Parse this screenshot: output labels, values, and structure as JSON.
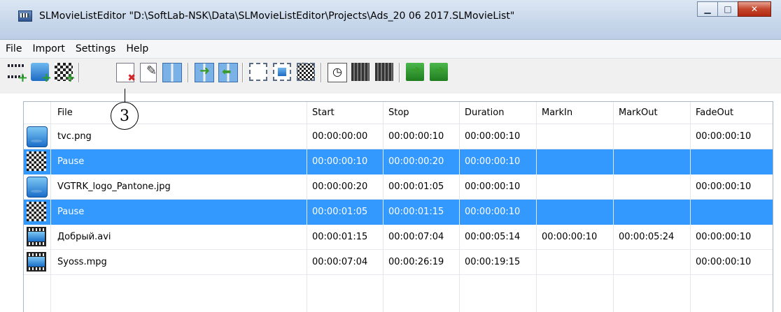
{
  "window": {
    "title": "SLMovieListEditor \"D:\\SoftLab-NSK\\Data\\SLMovieListEditor\\Projects\\Ads_20 06 2017.SLMovieList\"",
    "minimize_icon": "minimize-icon",
    "maximize_icon": "maximize-icon",
    "close_icon": "close-icon"
  },
  "menu": [
    "File",
    "Import",
    "Settings",
    "Help"
  ],
  "toolbar": {
    "icons": [
      "add-video-icon",
      "add-image-icon",
      "add-pause-icon",
      "delete-item-icon",
      "edit-item-icon",
      "split-icon",
      "move-right-icon",
      "move-left-icon",
      "frame-empty-icon",
      "frame-image-icon",
      "frame-checker-icon",
      "clock-icon",
      "video-strip-icon",
      "video-strip-2-icon",
      "copy-forward-icon",
      "copy-back-icon"
    ]
  },
  "callout": {
    "label": "3"
  },
  "table": {
    "columns": [
      "File",
      "Start",
      "Stop",
      "Duration",
      "MarkIn",
      "MarkOut",
      "FadeOut"
    ],
    "rows": [
      {
        "icon": "image-file-icon",
        "file": "tvc.png",
        "start": "00:00:00:00",
        "stop": "00:00:00:10",
        "duration": "00:00:00:10",
        "markin": "",
        "markout": "",
        "fadeout": "00:00:00:10",
        "selected": false
      },
      {
        "icon": "pause-icon",
        "file": "Pause",
        "start": "00:00:00:10",
        "stop": "00:00:00:20",
        "duration": "00:00:00:10",
        "markin": "",
        "markout": "",
        "fadeout": "",
        "selected": true
      },
      {
        "icon": "image-file-icon",
        "file": "VGTRK_logo_Pantone.jpg",
        "start": "00:00:00:20",
        "stop": "00:00:01:05",
        "duration": "00:00:00:10",
        "markin": "",
        "markout": "",
        "fadeout": "00:00:00:10",
        "selected": false
      },
      {
        "icon": "pause-icon",
        "file": "Pause",
        "start": "00:00:01:05",
        "stop": "00:00:01:15",
        "duration": "00:00:00:10",
        "markin": "",
        "markout": "",
        "fadeout": "",
        "selected": true
      },
      {
        "icon": "video-file-icon",
        "file": "Добрый.avi",
        "start": "00:00:01:15",
        "stop": "00:00:07:04",
        "duration": "00:00:05:14",
        "markin": "00:00:00:10",
        "markout": "00:00:05:24",
        "fadeout": "00:00:00:10",
        "selected": false
      },
      {
        "icon": "video-file-icon",
        "file": "Syoss.mpg",
        "start": "00:00:07:04",
        "stop": "00:00:26:19",
        "duration": "00:00:19:15",
        "markin": "",
        "markout": "",
        "fadeout": "00:00:00:10",
        "selected": false
      }
    ]
  }
}
